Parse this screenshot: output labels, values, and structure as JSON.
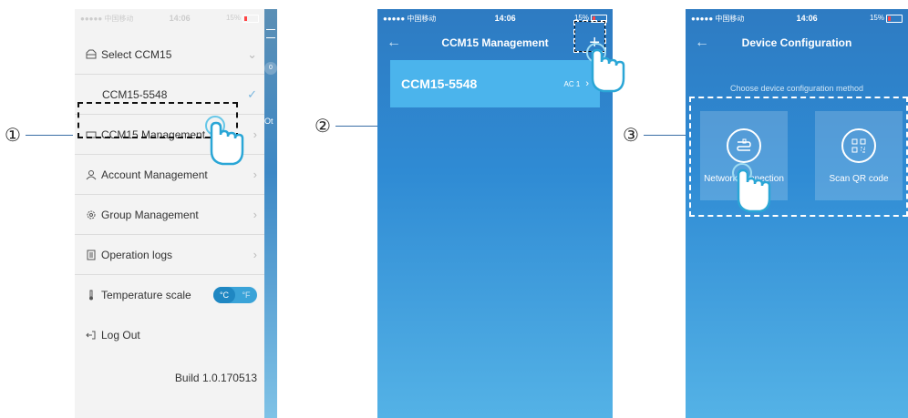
{
  "status": {
    "carrier": "●●●●● 中国移动",
    "time": "14:06",
    "battery": "15%"
  },
  "screen1": {
    "menu": [
      {
        "label": "Select CCM15",
        "icon": "folder-icon"
      },
      {
        "label": "CCM15-5548",
        "sub": true
      },
      {
        "label": "CCM15 Management",
        "icon": "device-icon"
      },
      {
        "label": "Account Management",
        "icon": "person-icon"
      },
      {
        "label": "Group Management",
        "icon": "gear-icon"
      },
      {
        "label": "Operation logs",
        "icon": "doc-icon"
      },
      {
        "label": "Temperature scale",
        "icon": "thermometer-icon"
      }
    ],
    "scale_c": "°C",
    "scale_f": "°F",
    "logout": "Log Out",
    "build": "Build 1.0.170513",
    "peek_number": "0",
    "peek_text": "Ot"
  },
  "screen2": {
    "title": "CCM15 Management",
    "device_name": "CCM15-5548",
    "device_tag": "AC 1"
  },
  "screen3": {
    "title": "Device Configuration",
    "subtitle": "Choose device configuration method",
    "option1": "Network connection",
    "option2": "Scan QR code"
  },
  "step_labels": [
    "①",
    "②",
    "③"
  ],
  "colors": {
    "accent_blue": "#2f8bd4",
    "card_blue": "#4bb4ec",
    "toggle_blue": "#3aa3d8"
  }
}
